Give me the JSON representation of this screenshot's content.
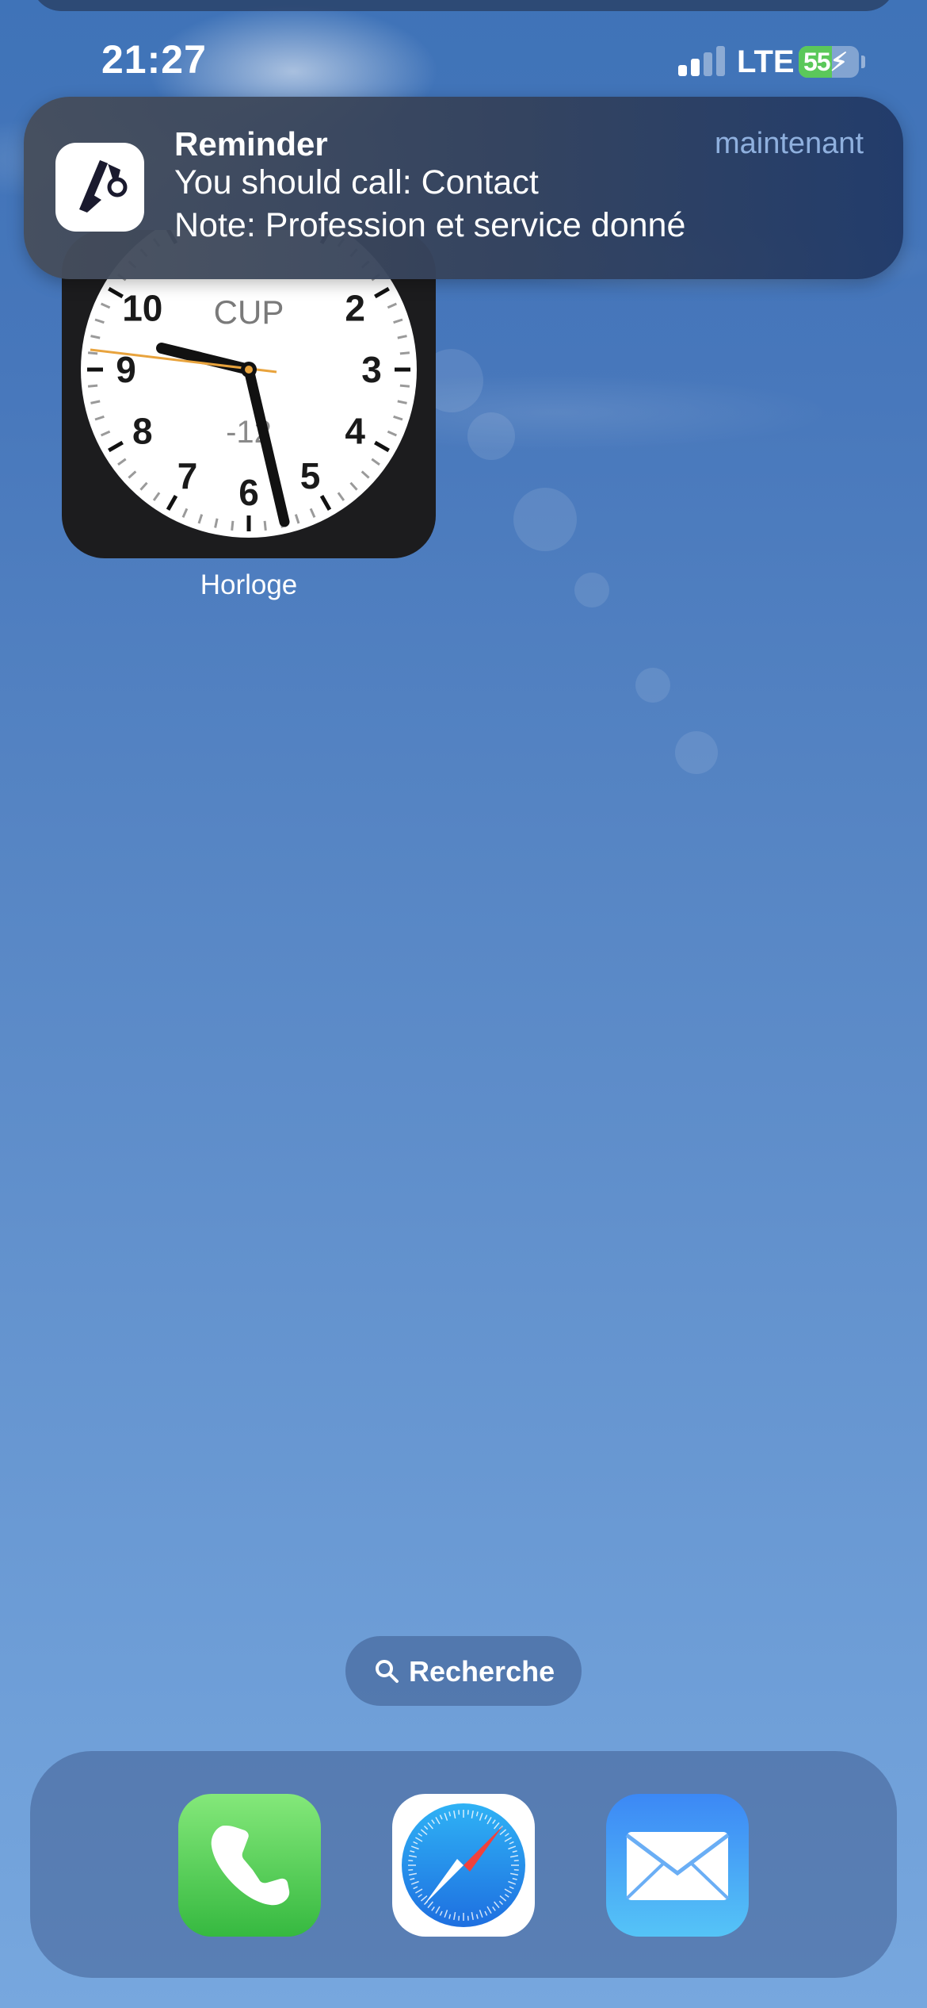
{
  "status_bar": {
    "time": "21:27",
    "network": "LTE",
    "battery_percent": "55",
    "battery_charging": true,
    "signal_bars_active": 2,
    "signal_bars_total": 4
  },
  "notification": {
    "app_icon": "reminder-app-icon",
    "title": "Reminder",
    "time": "maintenant",
    "line1": "You should call: Contact",
    "line2": "Note: Profession et service donné"
  },
  "clock_widget": {
    "label": "Horloge",
    "city": "CUP",
    "offset": "-12",
    "numerals": [
      "10",
      "2",
      "9",
      "3",
      "8",
      "4",
      "7",
      "5",
      "6"
    ],
    "time_shown": "21:27",
    "second_hand_color": "#e8a33d"
  },
  "search": {
    "label": "Recherche",
    "icon": "search-icon"
  },
  "dock": {
    "apps": [
      {
        "name": "Téléphone",
        "icon": "phone-icon"
      },
      {
        "name": "Safari",
        "icon": "compass-icon"
      },
      {
        "name": "Mail",
        "icon": "envelope-icon"
      }
    ]
  }
}
